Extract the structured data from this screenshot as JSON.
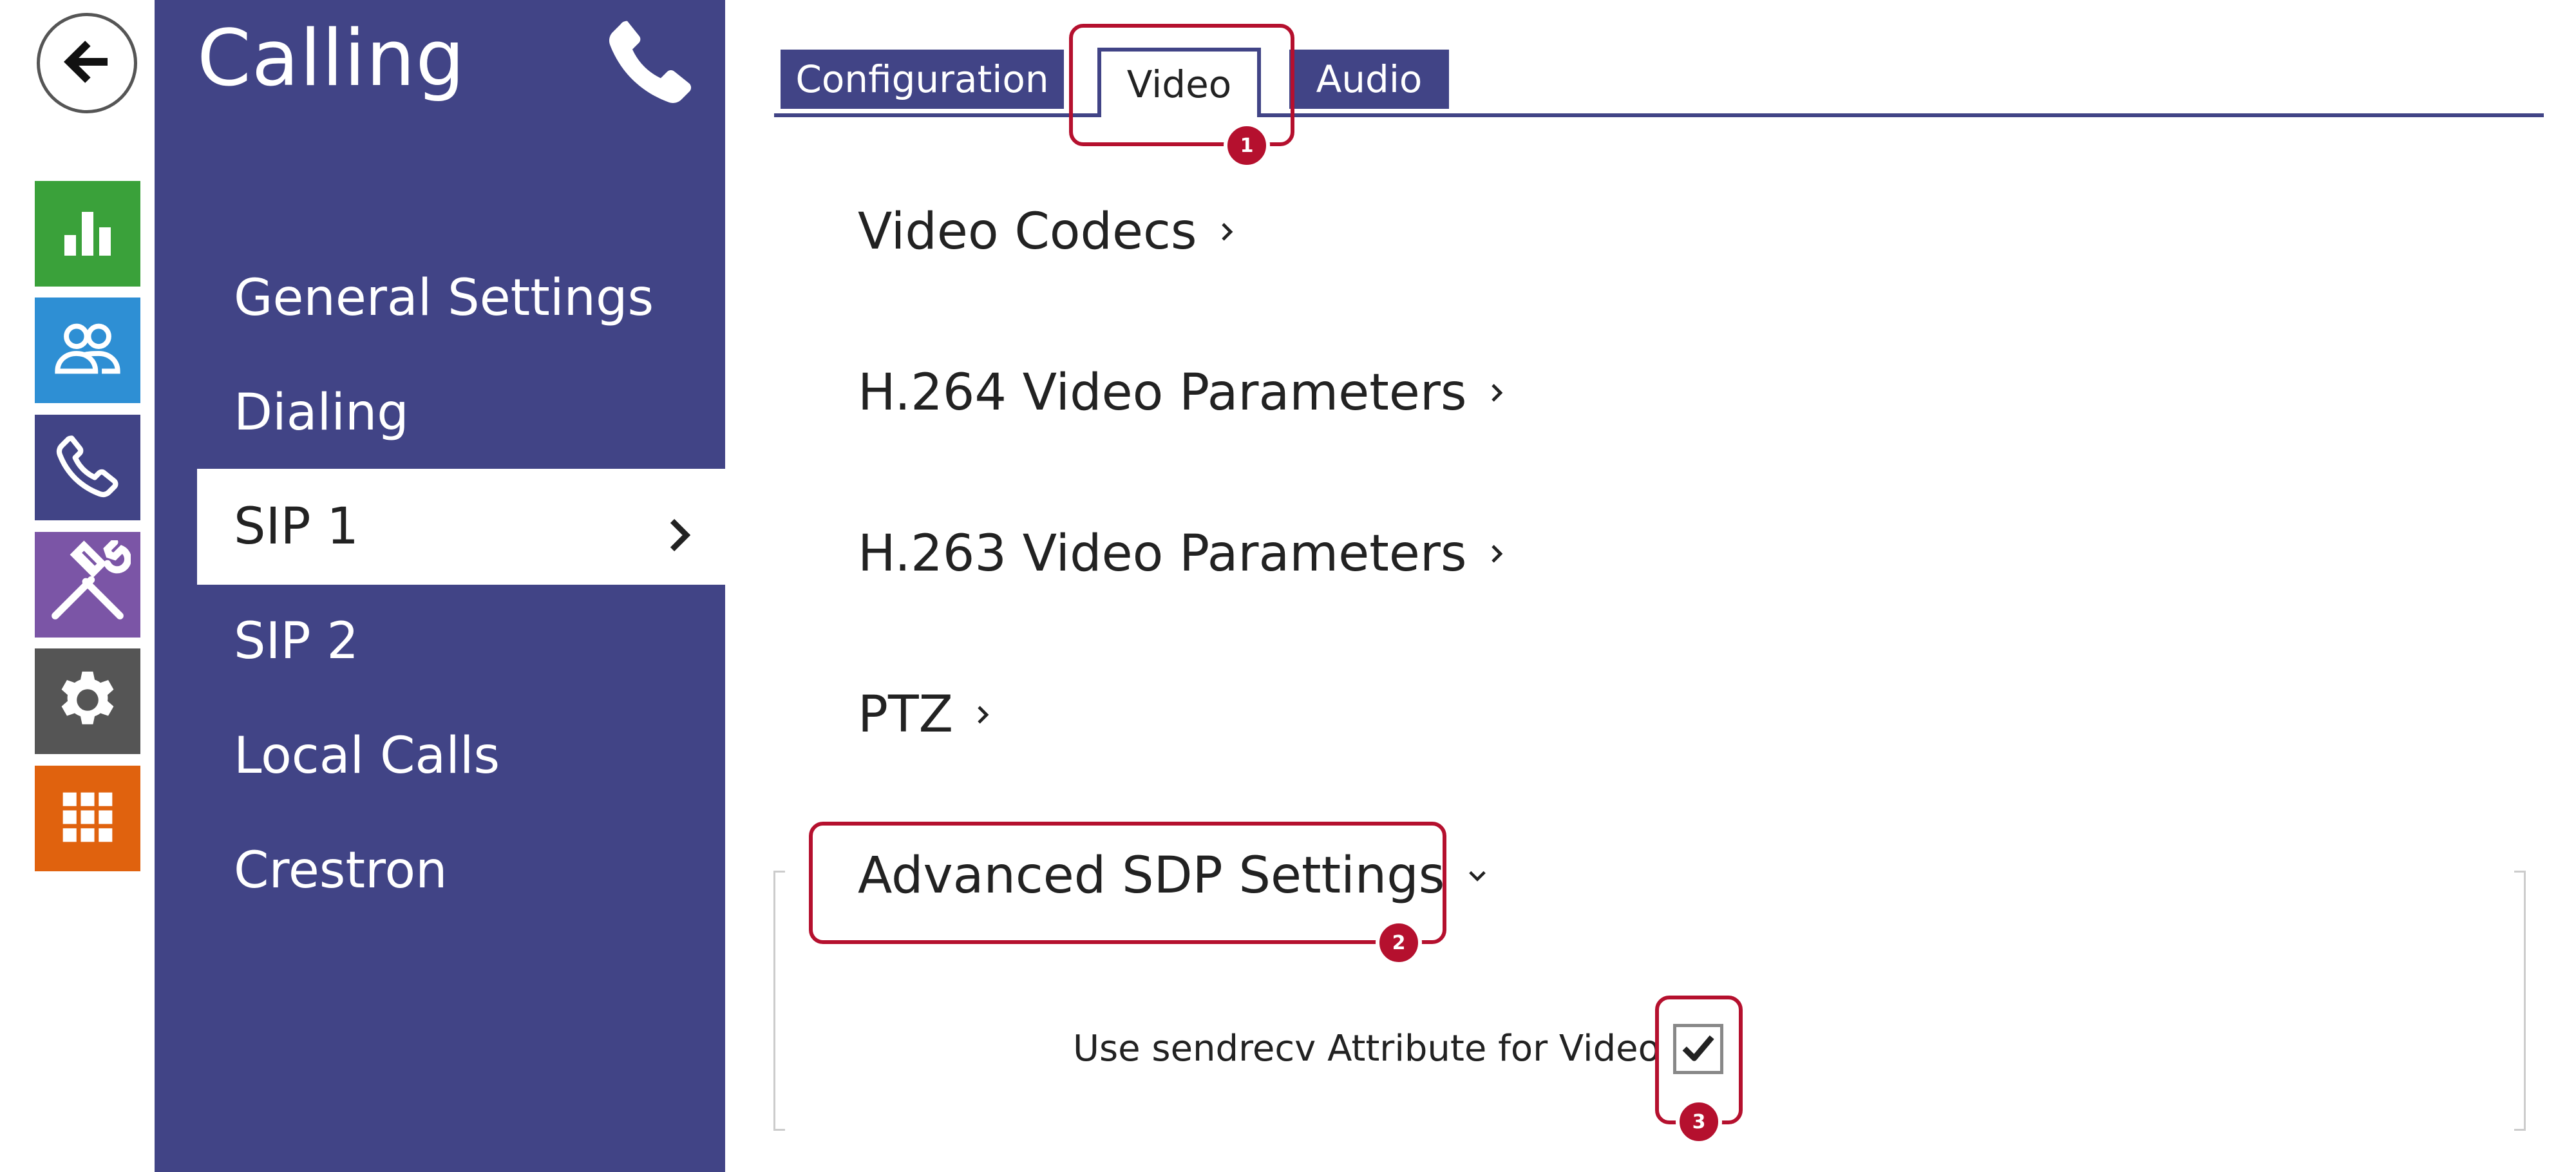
{
  "colors": {
    "nav_background": "#414486",
    "accent": "#414486",
    "callout": "#b5102e",
    "status_tile": "#3aa13a",
    "directory_tile": "#2e8fd4",
    "calling_tile": "#414486",
    "hardware_tile": "#7b55a6",
    "services_tile": "#555555",
    "system_tile": "#e0620e"
  },
  "rail": {
    "back_icon": "arrow-left-icon",
    "items": [
      {
        "icon": "bar-chart-icon"
      },
      {
        "icon": "users-icon"
      },
      {
        "icon": "phone-icon"
      },
      {
        "icon": "tools-icon"
      },
      {
        "icon": "gear-icon"
      },
      {
        "icon": "grid-icon"
      }
    ]
  },
  "nav": {
    "title": "Calling",
    "title_icon": "phone-icon",
    "items": [
      {
        "label": "General Settings"
      },
      {
        "label": "Dialing"
      },
      {
        "label": "SIP 1",
        "active": true
      },
      {
        "label": "SIP 2"
      },
      {
        "label": "Local Calls"
      },
      {
        "label": "Crestron"
      }
    ]
  },
  "tabs": [
    {
      "label": "Configuration"
    },
    {
      "label": "Video",
      "active": true
    },
    {
      "label": "Audio"
    }
  ],
  "sections": [
    {
      "label": "Video Codecs",
      "state": "collapsed"
    },
    {
      "label": "H.264 Video Parameters",
      "state": "collapsed"
    },
    {
      "label": "H.263 Video Parameters",
      "state": "collapsed"
    },
    {
      "label": "PTZ",
      "state": "collapsed"
    },
    {
      "label": "Advanced SDP Settings",
      "state": "expanded"
    }
  ],
  "sdp": {
    "setting_label": "Use sendrecv Attribute for Video",
    "checked": true
  },
  "callouts": [
    "1",
    "2",
    "3"
  ]
}
